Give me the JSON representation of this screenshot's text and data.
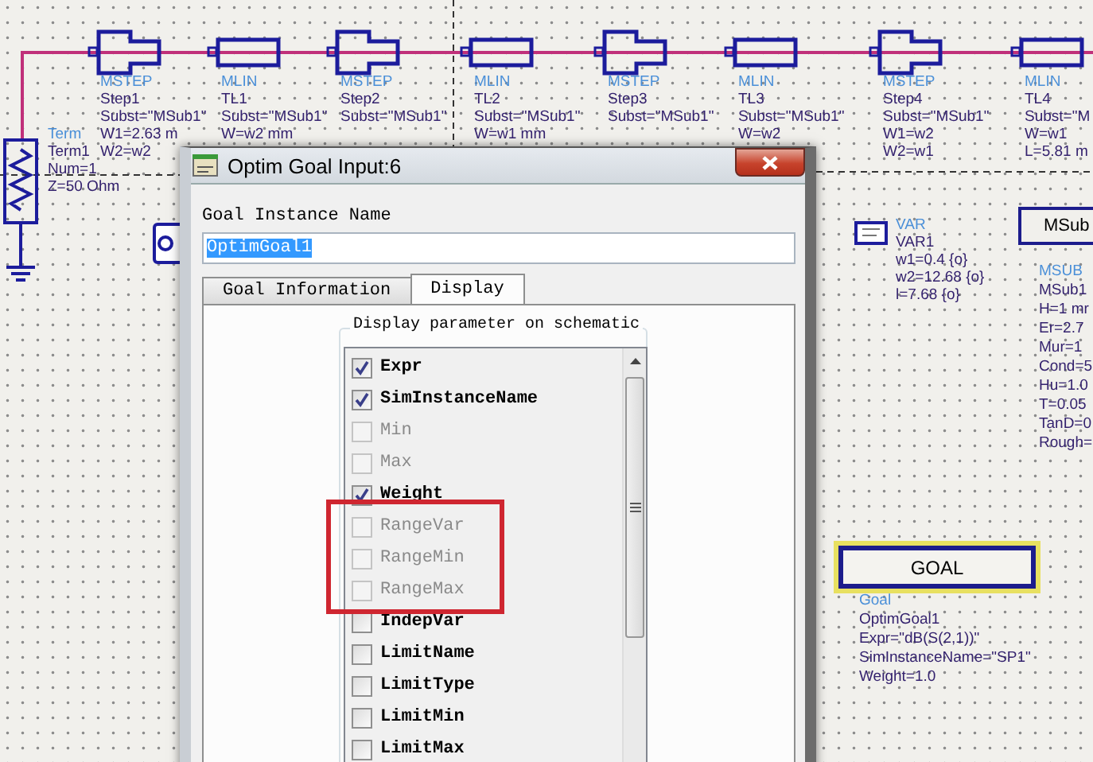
{
  "schematic": {
    "components": [
      {
        "kind": "term",
        "lines": [
          "Term",
          "Term1",
          "Num=1",
          "Z=50 Ohm"
        ]
      },
      {
        "kind": "mstep",
        "lines": [
          "MSTEP",
          "Step1",
          "Subst=\"MSub1\"",
          "W1=2.63 m",
          "W2=w2"
        ]
      },
      {
        "kind": "mlin",
        "lines": [
          "MLIN",
          "TL1",
          "Subst=\"MSub1\"",
          "W=w2 mm"
        ]
      },
      {
        "kind": "mstep",
        "lines": [
          "MSTEP",
          "Step2",
          "Subst=\"MSub1\""
        ]
      },
      {
        "kind": "mlin",
        "lines": [
          "MLIN",
          "TL2",
          "Subst=\"MSub1\"",
          "W=w1 mm"
        ]
      },
      {
        "kind": "mstep",
        "lines": [
          "MSTEP",
          "Step3",
          "Subst=\"MSub1\""
        ]
      },
      {
        "kind": "mlin",
        "lines": [
          "MLIN",
          "TL3",
          "Subst=\"MSub1\"",
          "W=w2"
        ]
      },
      {
        "kind": "mstep",
        "lines": [
          "MSTEP",
          "Step4",
          "Subst=\"MSub1\"",
          "W1=w2",
          "W2=w1"
        ]
      },
      {
        "kind": "mlin",
        "lines": [
          "MLIN",
          "TL4",
          "Subst=\"M",
          "W=w1",
          "L=5.81 m"
        ]
      },
      {
        "kind": "var",
        "lines": [
          "VAR",
          "VAR1",
          "w1=0.4 {o}",
          "w2=12.68 {o}",
          "l=7.68 {o}"
        ]
      },
      {
        "kind": "msub",
        "box_label": "MSub",
        "lines": [
          "MSUB",
          "MSub1",
          "H=1 mr",
          "Er=2.7",
          "Mur=1",
          "Cond=5",
          "Hu=1.0",
          "T=0.05",
          "TanD=0",
          "Rough="
        ]
      },
      {
        "kind": "goal",
        "box_label": "GOAL",
        "lines": [
          "Goal",
          "OptimGoal1",
          "Expr=\"dB(S(2,1))\"",
          "SimInstanceName=\"SP1\"",
          "Weight=1.0"
        ]
      }
    ]
  },
  "dialog": {
    "title": "Optim Goal Input:6",
    "name_label": "Goal Instance Name",
    "name_value": "OptimGoal1",
    "name_value_selected": true,
    "tabs": [
      {
        "label": "Goal Information",
        "selected": false
      },
      {
        "label": "Display",
        "selected": true
      }
    ],
    "group_title": "Display parameter on schematic",
    "parameters": [
      {
        "label": "Expr",
        "checked": true,
        "disabled": false
      },
      {
        "label": "SimInstanceName",
        "checked": true,
        "disabled": false
      },
      {
        "label": "Min",
        "checked": false,
        "disabled": true
      },
      {
        "label": "Max",
        "checked": false,
        "disabled": true
      },
      {
        "label": "Weight",
        "checked": true,
        "disabled": false
      },
      {
        "label": "RangeVar",
        "checked": false,
        "disabled": true
      },
      {
        "label": "RangeMin",
        "checked": false,
        "disabled": true
      },
      {
        "label": "RangeMax",
        "checked": false,
        "disabled": true
      },
      {
        "label": "IndepVar",
        "checked": false,
        "disabled": false
      },
      {
        "label": "LimitName",
        "checked": false,
        "disabled": false
      },
      {
        "label": "LimitType",
        "checked": false,
        "disabled": false
      },
      {
        "label": "LimitMin",
        "checked": false,
        "disabled": false
      },
      {
        "label": "LimitMax",
        "checked": false,
        "disabled": false
      }
    ]
  }
}
